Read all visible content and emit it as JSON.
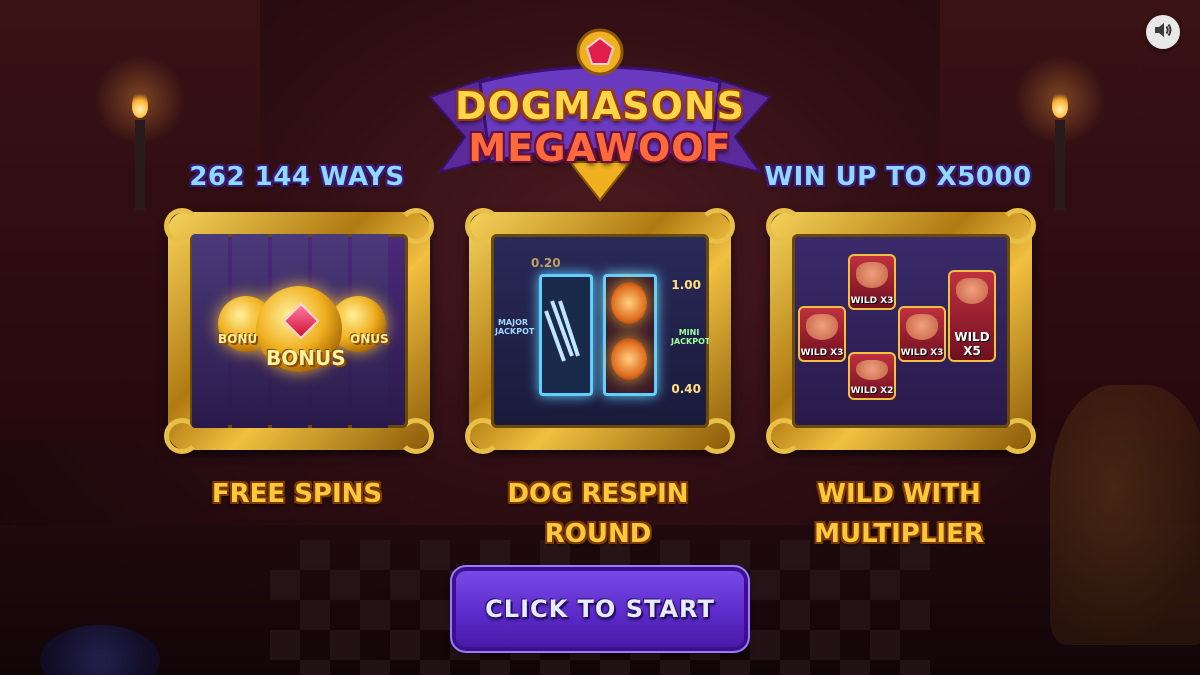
{
  "game": {
    "logo_line1": "DOGMASONS",
    "logo_line2": "MEGAWOOF"
  },
  "features": [
    {
      "headline": "262 144 WAYS",
      "caption_line1": "FREE SPINS",
      "caption_line2": ""
    },
    {
      "headline": "",
      "caption_line1": "DOG RESPIN",
      "caption_line2": "ROUND"
    },
    {
      "headline": "WIN UP TO X5000",
      "caption_line1": "WILD WITH",
      "caption_line2": "MULTIPLIER"
    }
  ],
  "panel1": {
    "bonus_text": "BONUS",
    "side_left": "BONU",
    "side_right": "ONUS"
  },
  "panel2": {
    "jackpot_major": "MAJOR JACKPOT",
    "jackpot_mini": "MINI JACKPOT",
    "value_top_left": "0.20",
    "value_top_right": "1.00",
    "value_bottom_right": "0.40"
  },
  "panel3": {
    "wild_labels": [
      "WILD X3",
      "WILD X3",
      "WILD X3",
      "WILD X5",
      "WILD X2"
    ]
  },
  "start_button": {
    "label": "CLICK TO START"
  },
  "sound": {
    "icon": "speaker-icon"
  },
  "colors": {
    "accent_purple": "#6a3ae0",
    "gold": "#ffc83a",
    "headline_blue": "#8fd8ff"
  }
}
